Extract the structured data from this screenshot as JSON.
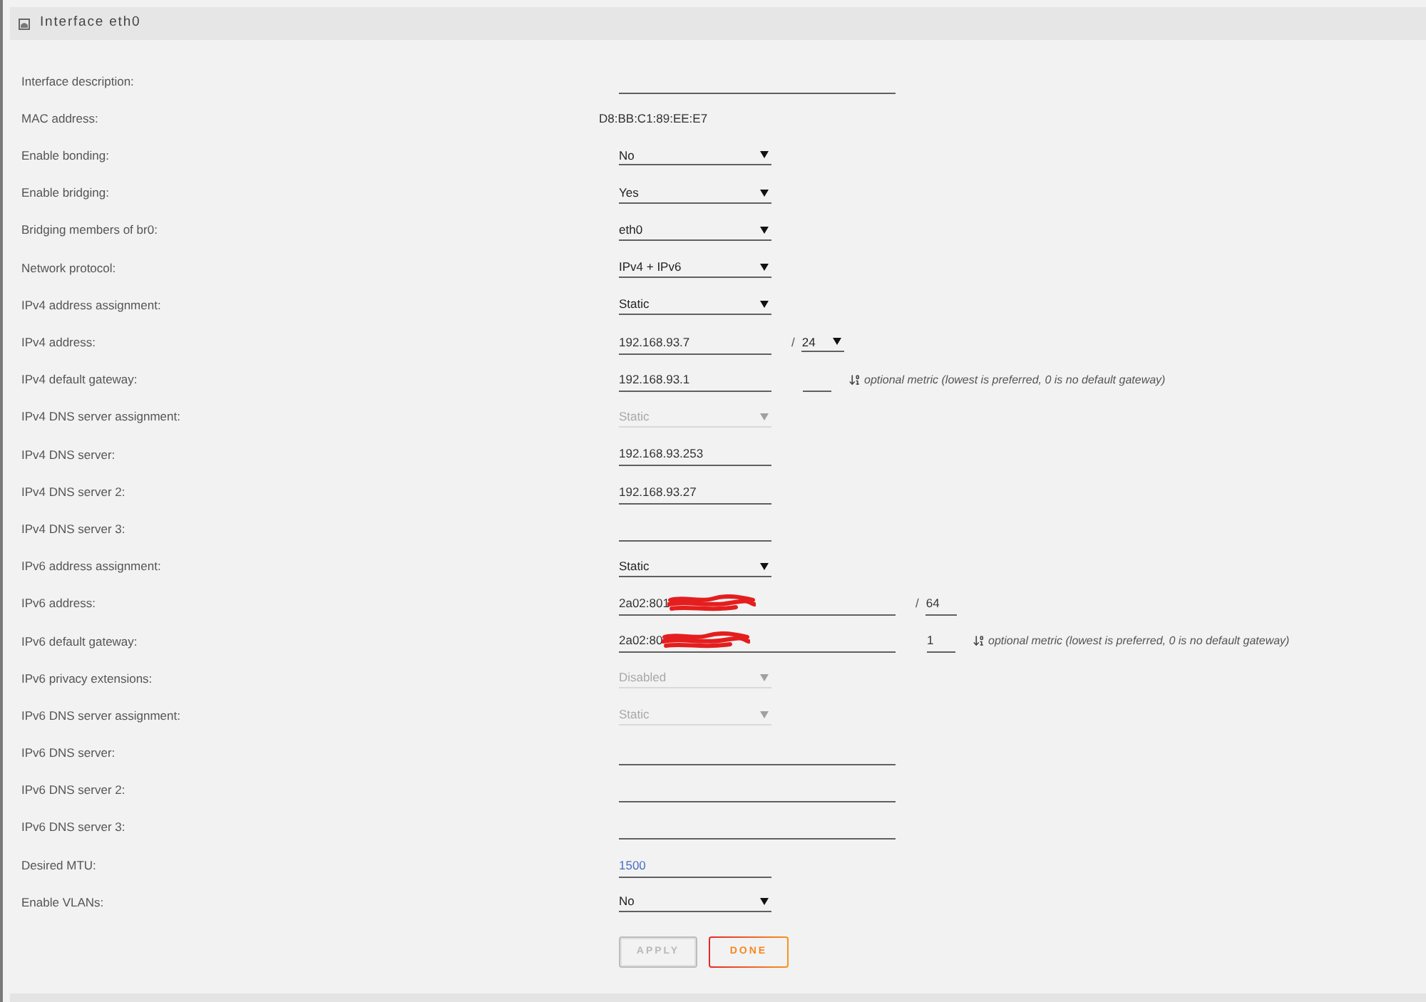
{
  "panel": {
    "title": "Interface eth0"
  },
  "fields": [
    {
      "label": "Interface description:",
      "kind": "wide_input",
      "disabled": false
    },
    {
      "label": "MAC address:",
      "kind": "readonly",
      "value": "D8:BB:C1:89:EE:E7",
      "disabled": false
    },
    {
      "label": "Enable bonding:",
      "kind": "select",
      "value": "No",
      "disabled": false
    },
    {
      "label": "Enable bridging:",
      "kind": "select",
      "value": "Yes",
      "disabled": false
    },
    {
      "label": "Bridging members of br0:",
      "kind": "select",
      "value": "eth0",
      "disabled": false
    },
    {
      "label": "Network protocol:",
      "kind": "select",
      "value": "IPv4 + IPv6",
      "disabled": false
    },
    {
      "label": "IPv4 address assignment:",
      "kind": "select",
      "value": "Static",
      "disabled": false
    },
    {
      "label": "IPv4 address:",
      "kind": "input",
      "value": "192.168.93.7",
      "disabled": false,
      "prefix": {
        "separator": "/",
        "kind": "select",
        "value": "24"
      }
    },
    {
      "label": "IPv4 default gateway:",
      "kind": "input",
      "value": "192.168.93.1",
      "disabled": false,
      "metric": {
        "hint": "optional metric (lowest is preferred, 0 is no default gateway)"
      }
    },
    {
      "label": "IPv4 DNS server assignment:",
      "kind": "select",
      "value": "Static",
      "disabled": true
    },
    {
      "label": "IPv4 DNS server:",
      "kind": "input",
      "value": "192.168.93.253",
      "disabled": false
    },
    {
      "label": "IPv4 DNS server 2:",
      "kind": "input",
      "value": "192.168.93.27",
      "disabled": false
    },
    {
      "label": "IPv4 DNS server 3:",
      "kind": "input",
      "disabled": false
    },
    {
      "label": "IPv6 address assignment:",
      "kind": "select",
      "value": "Static",
      "disabled": false
    },
    {
      "label": "IPv6 address:",
      "kind": "wide_input",
      "value": "2a02:801",
      "redacted": true,
      "disabled": false,
      "prefix": {
        "separator": "/",
        "kind": "input",
        "value": "64"
      }
    },
    {
      "label": "IPv6 default gateway:",
      "kind": "wide_input",
      "value": "2a02:80",
      "redacted": true,
      "disabled": false,
      "metric": {
        "value": "1",
        "hint": "optional metric (lowest is preferred, 0 is no default gateway)"
      }
    },
    {
      "label": "IPv6 privacy extensions:",
      "kind": "select",
      "value": "Disabled",
      "disabled": true
    },
    {
      "label": "IPv6 DNS server assignment:",
      "kind": "select",
      "value": "Static",
      "disabled": true
    },
    {
      "label": "IPv6 DNS server:",
      "kind": "wide_input",
      "disabled": false
    },
    {
      "label": "IPv6 DNS server 2:",
      "kind": "wide_input",
      "disabled": false
    },
    {
      "label": "IPv6 DNS server 3:",
      "kind": "wide_input",
      "disabled": false
    },
    {
      "label": "Desired MTU:",
      "kind": "input",
      "placeholder": "1500",
      "disabled": false
    },
    {
      "label": "Enable VLANs:",
      "kind": "select",
      "value": "No",
      "disabled": false
    }
  ],
  "buttons": [
    {
      "label": "APPLY",
      "disabled": true
    },
    {
      "label": "DONE",
      "disabled": false
    }
  ]
}
